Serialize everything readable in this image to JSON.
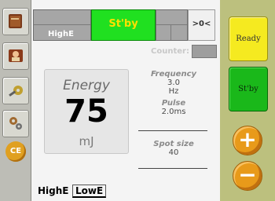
{
  "left_toolbar": {
    "items": [
      {
        "icon": "book-icon"
      },
      {
        "icon": "person-icon"
      },
      {
        "icon": "tools-icon"
      },
      {
        "icon": "settings-icon"
      }
    ],
    "ce_label": "CE"
  },
  "status_bar": {
    "mode_label": "HighE",
    "state_label": "St'by",
    "nav_label": ">0<"
  },
  "counter": {
    "label": "Counter:"
  },
  "energy": {
    "title": "Energy",
    "value": "75",
    "unit": "mJ"
  },
  "parameters": {
    "frequency_label": "Frequency",
    "frequency_value": "3.0",
    "frequency_unit": "Hz",
    "pulse_label": "Pulse",
    "pulse_value": "2.0ms",
    "spot_size_label": "Spot size",
    "spot_size_value": "40"
  },
  "bottom_tabs": {
    "tab1": "HighE",
    "tab2": "LowE"
  },
  "right_panel": {
    "ready_label": "Ready",
    "stby_label": "St'by",
    "plus_label": "+",
    "minus_label": "−"
  },
  "colors": {
    "ready": "#f5ea20",
    "standby": "#1ab81a",
    "status_active": "#20e020",
    "adjust_buttons": "#e89a1a"
  }
}
